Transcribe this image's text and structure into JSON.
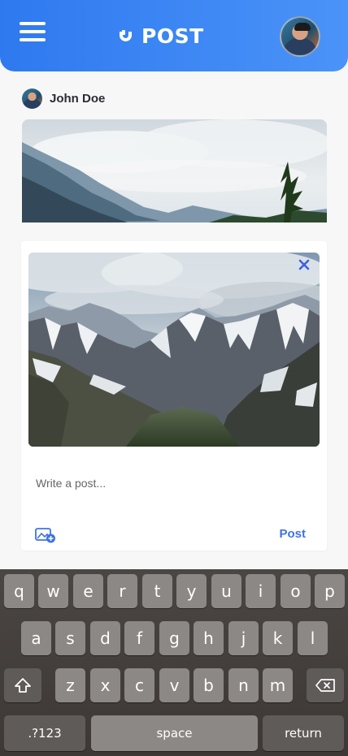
{
  "header": {
    "brand": "POST",
    "menu_icon": "hamburger-menu-icon",
    "avatar_icon": "user-avatar"
  },
  "feed": {
    "author_name": "John Doe"
  },
  "composer": {
    "placeholder": "Write a post...",
    "post_label": "Post",
    "close_icon": "close-icon",
    "add_image_icon": "add-image-icon",
    "accent_color": "#3f72e6"
  },
  "keyboard": {
    "row1": [
      "q",
      "w",
      "e",
      "r",
      "t",
      "y",
      "u",
      "i",
      "o",
      "p"
    ],
    "row2": [
      "a",
      "s",
      "d",
      "f",
      "g",
      "h",
      "j",
      "k",
      "l"
    ],
    "row3": [
      "z",
      "x",
      "c",
      "v",
      "b",
      "n",
      "m"
    ],
    "shift_icon": "shift-icon",
    "backspace_icon": "backspace-icon",
    "numbers_label": ".?123",
    "space_label": "space",
    "return_label": "return"
  }
}
